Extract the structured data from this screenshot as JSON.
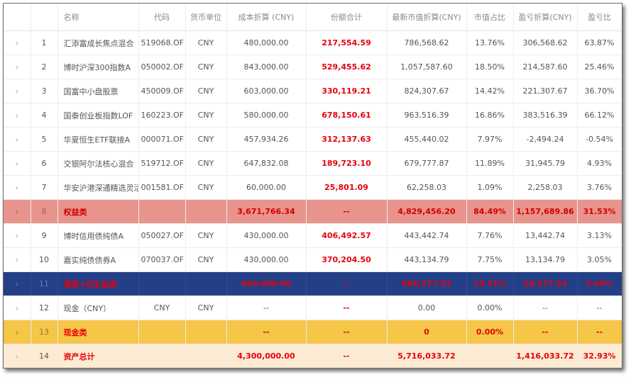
{
  "headers": [
    "",
    "",
    "名称",
    "代码",
    "货币单位",
    "成本折算 (CNY)",
    "份额合计",
    "最新市值折算(CNY)",
    "市值占比",
    "盈亏折算(CNY)",
    "盈亏比"
  ],
  "expand_glyph": "›",
  "rows": [
    {
      "kind": "item",
      "idx": "1",
      "name": "汇添富成长焦点混合",
      "code": "519068.OF",
      "currency": "CNY",
      "cost": "480,000.00",
      "shares": "217,554.59",
      "mv": "786,568.62",
      "pct": "13.76%",
      "pnl": "306,568.62",
      "ratio": "63.87%"
    },
    {
      "kind": "item",
      "idx": "2",
      "name": "博时沪深300指数A",
      "code": "050002.OF",
      "currency": "CNY",
      "cost": "843,000.00",
      "shares": "529,455.62",
      "mv": "1,057,587.60",
      "pct": "18.50%",
      "pnl": "214,587.60",
      "ratio": "25.46%"
    },
    {
      "kind": "item",
      "idx": "3",
      "name": "国富中小盘股票",
      "code": "450009.OF",
      "currency": "CNY",
      "cost": "603,000.00",
      "shares": "330,119.21",
      "mv": "824,307.67",
      "pct": "14.42%",
      "pnl": "221,307.67",
      "ratio": "36.70%"
    },
    {
      "kind": "item",
      "idx": "4",
      "name": "国泰创业板指数LOF",
      "code": "160223.OF",
      "currency": "CNY",
      "cost": "580,000.00",
      "shares": "678,150.61",
      "mv": "963,516.39",
      "pct": "16.86%",
      "pnl": "383,516.39",
      "ratio": "66.12%"
    },
    {
      "kind": "item",
      "idx": "5",
      "name": "华夏恒生ETF联接A",
      "code": "000071.OF",
      "currency": "CNY",
      "cost": "457,934.26",
      "shares": "312,137.63",
      "mv": "455,440.02",
      "pct": "7.97%",
      "pnl": "-2,494.24",
      "ratio": "-0.54%"
    },
    {
      "kind": "item",
      "idx": "6",
      "name": "交银阿尔法核心混合",
      "code": "519712.OF",
      "currency": "CNY",
      "cost": "647,832.08",
      "shares": "189,723.10",
      "mv": "679,777.87",
      "pct": "11.89%",
      "pnl": "31,945.79",
      "ratio": "4.93%"
    },
    {
      "kind": "item",
      "idx": "7",
      "name": "华安沪港深通精选灵活配",
      "code": "001581.OF",
      "currency": "CNY",
      "cost": "60,000.00",
      "shares": "25,801.09",
      "mv": "62,258.03",
      "pct": "1.09%",
      "pnl": "2,258.03",
      "ratio": "3.76%"
    },
    {
      "kind": "equity",
      "idx": "8",
      "name": "权益类",
      "code": "",
      "currency": "",
      "cost": "3,671,766.34",
      "shares": "--",
      "mv": "4,829,456.20",
      "pct": "84.49%",
      "pnl": "1,157,689.86",
      "ratio": "31.53%"
    },
    {
      "kind": "item",
      "idx": "9",
      "name": "博时信用债纯债A",
      "code": "050027.OF",
      "currency": "CNY",
      "cost": "430,000.00",
      "shares": "406,492.57",
      "mv": "443,442.74",
      "pct": "7.76%",
      "pnl": "13,442.74",
      "ratio": "3.13%"
    },
    {
      "kind": "item",
      "idx": "10",
      "name": "嘉实纯债债券A",
      "code": "070037.OF",
      "currency": "CNY",
      "cost": "430,000.00",
      "shares": "370,204.50",
      "mv": "443,134.79",
      "pct": "7.75%",
      "pnl": "13,134.79",
      "ratio": "3.05%"
    },
    {
      "kind": "bond",
      "idx": "11",
      "name": "债类+衍生品类",
      "code": "",
      "currency": "",
      "cost": "860,000.00",
      "shares": "--",
      "mv": "886,577.53",
      "pct": "15.51%",
      "pnl": "26,577.53",
      "ratio": "3.09%"
    },
    {
      "kind": "item",
      "idx": "12",
      "name": "现金（CNY）",
      "code": "CNY",
      "currency": "CNY",
      "cost": "--",
      "shares": "--",
      "mv": "0.00",
      "pct": "0.00%",
      "pnl": "--",
      "ratio": "--"
    },
    {
      "kind": "cash",
      "idx": "13",
      "name": "现金类",
      "code": "",
      "currency": "",
      "cost": "--",
      "shares": "--",
      "mv": "0",
      "pct": "0.00%",
      "pnl": "--",
      "ratio": "--"
    },
    {
      "kind": "total",
      "idx": "14",
      "name": "资产总计",
      "code": "",
      "currency": "",
      "cost": "4,300,000.00",
      "shares": "--",
      "mv": "5,716,033.72",
      "pct": "",
      "pnl": "1,416,033.72",
      "ratio": "32.93%"
    }
  ]
}
